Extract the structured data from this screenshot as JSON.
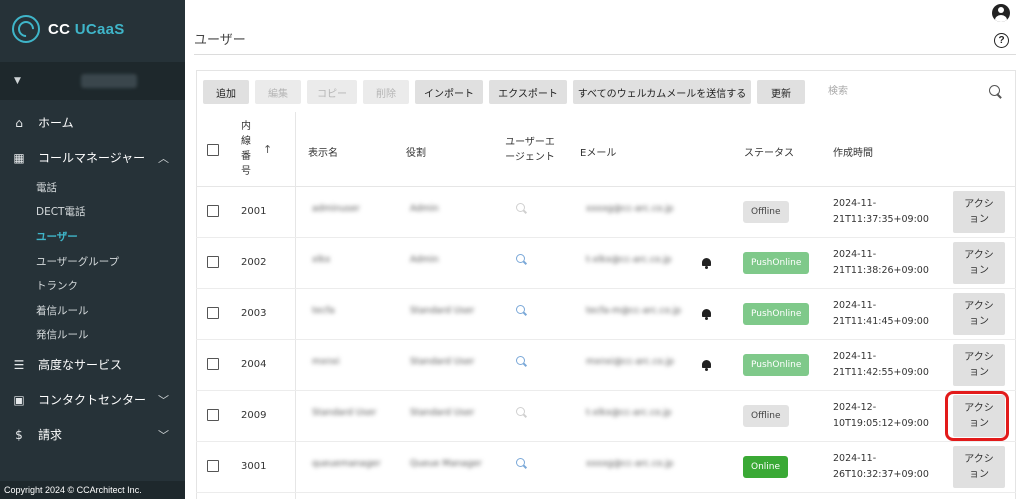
{
  "sidebar": {
    "brand": {
      "prefix": "CC ",
      "suffix": "UCaaS"
    },
    "nav": [
      {
        "label": "ホーム",
        "icon": "home-icon"
      },
      {
        "label": "コールマネージャー",
        "icon": "grid-icon",
        "expanded": true
      }
    ],
    "sub_items": [
      "電話",
      "DECT電話",
      "ユーザー",
      "ユーザーグループ",
      "トランク",
      "着信ルール",
      "発信ルール"
    ],
    "active_sub": "ユーザー",
    "nav_bottom": [
      {
        "label": "高度なサービス",
        "icon": "list-icon"
      },
      {
        "label": "コンタクトセンター",
        "icon": "clipboard-icon"
      },
      {
        "label": "請求",
        "icon": "dollar-icon"
      }
    ],
    "copyright": "Copyright 2024 © CCArchitect Inc."
  },
  "header": {
    "title": "ユーザー"
  },
  "toolbar": {
    "add": "追加",
    "edit": "編集",
    "copy": "コピー",
    "delete": "削除",
    "import": "インポート",
    "export": "エクスポート",
    "send_welcome": "すべてのウェルカムメールを送信する",
    "refresh": "更新"
  },
  "search": {
    "placeholder": "検索"
  },
  "table": {
    "headers": {
      "ext": "内線番号",
      "display_name": "表示名",
      "role": "役割",
      "user_agent": "ユーザーエージェント",
      "email": "Eメール",
      "status": "ステータス",
      "created": "作成時間"
    },
    "rows": [
      {
        "ext": "2001",
        "name": "adminuser",
        "role": "Admin",
        "email": "xxxxg@cc-arc.co.jp",
        "ua_active": false,
        "bell": false,
        "status": "Offline",
        "status_type": "offline",
        "created_1": "2024-11-",
        "created_2": "21T11:37:35+09:00",
        "action": "アクション"
      },
      {
        "ext": "2002",
        "name": "xlkx",
        "role": "Admin",
        "email": "t-xlkx@cc-arc.co.jp",
        "ua_active": true,
        "bell": true,
        "status": "PushOnline",
        "status_type": "push",
        "created_1": "2024-11-",
        "created_2": "21T11:38:26+09:00",
        "action": "アクション"
      },
      {
        "ext": "2003",
        "name": "tecfa",
        "role": "Standard User",
        "email": "tecfa-m@cc-arc.co.jp",
        "ua_active": true,
        "bell": true,
        "status": "PushOnline",
        "status_type": "push",
        "created_1": "2024-11-",
        "created_2": "21T11:41:45+09:00",
        "action": "アクション"
      },
      {
        "ext": "2004",
        "name": "mxnxi",
        "role": "Standard User",
        "email": "mxnxi@cc-arc.co.jp",
        "ua_active": true,
        "bell": true,
        "status": "PushOnline",
        "status_type": "push",
        "created_1": "2024-11-",
        "created_2": "21T11:42:55+09:00",
        "action": "アクション"
      },
      {
        "ext": "2009",
        "name": "Standard User",
        "role": "Standard User",
        "email": "t-xlkx@cc-arc.co.jp",
        "ua_active": false,
        "bell": false,
        "status": "Offline",
        "status_type": "offline",
        "created_1": "2024-12-",
        "created_2": "10T19:05:12+09:00",
        "action": "アクション"
      },
      {
        "ext": "3001",
        "name": "queuemanager",
        "role": "Queue Manager",
        "email": "xxxxg@cc-arc.co.jp",
        "ua_active": true,
        "bell": false,
        "status": "Online",
        "status_type": "online",
        "created_1": "2024-11-",
        "created_2": "26T10:32:37+09:00",
        "action": "アクション"
      }
    ]
  },
  "colors": {
    "sidebar_bg": "#263238",
    "accent": "#3fb5c9",
    "push_online": "#7fc98a",
    "online": "#3aa935",
    "highlight": "#e21a1a"
  }
}
